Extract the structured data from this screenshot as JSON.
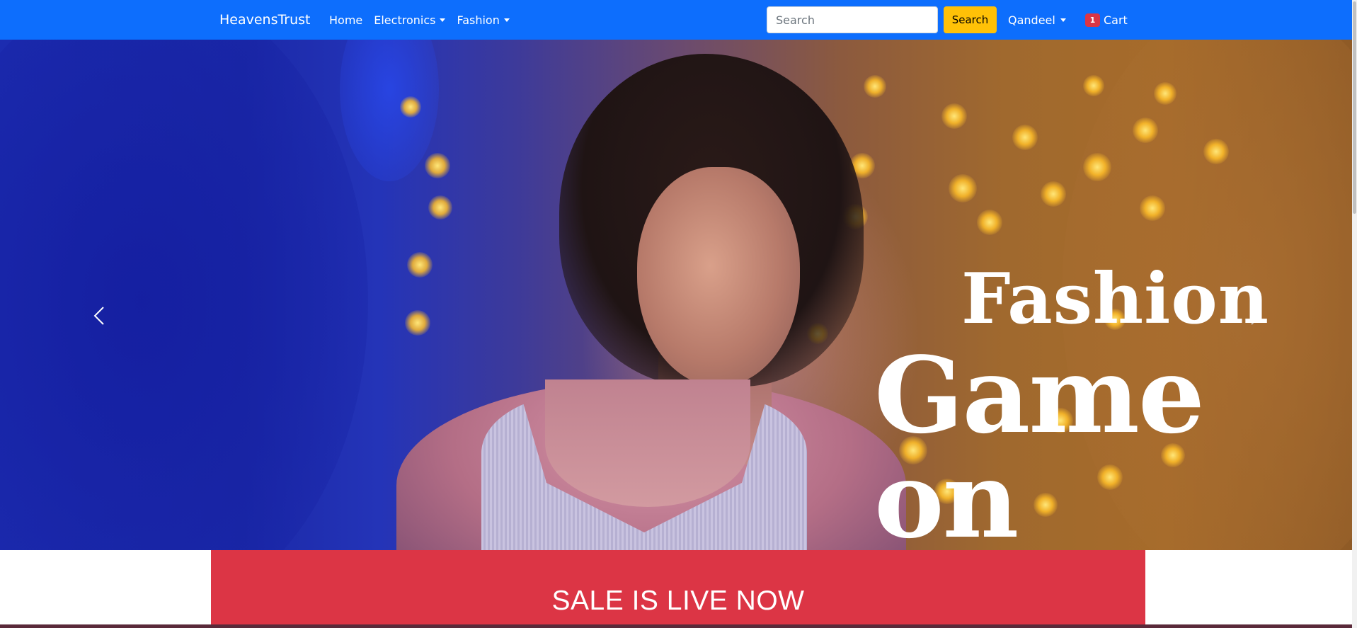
{
  "navbar": {
    "brand": "HeavensTrust",
    "links": [
      {
        "label": "Home",
        "dropdown": false
      },
      {
        "label": "Electronics",
        "dropdown": true
      },
      {
        "label": "Fashion",
        "dropdown": true
      }
    ],
    "search": {
      "placeholder": "Search",
      "value": "",
      "button_label": "Search"
    },
    "user": {
      "label": "Qandeel"
    },
    "cart": {
      "count": "1",
      "label": "Cart"
    },
    "colors": {
      "navbar": "#0d6efd",
      "search_button": "#ffc107",
      "badge": "#dc3545"
    }
  },
  "hero": {
    "caption_line1": "Fashion",
    "caption_line2": "Game on",
    "prev_icon": "chevron-left-icon",
    "next_icon": "chevron-right-icon"
  },
  "sale": {
    "text": "SALE IS LIVE NOW",
    "color": "#dc3545"
  }
}
